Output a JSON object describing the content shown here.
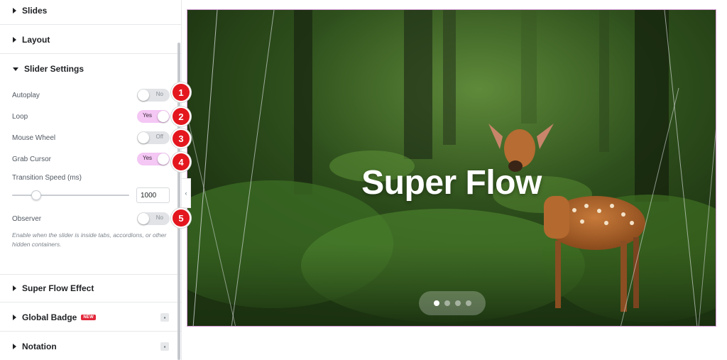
{
  "panel": {
    "sections_top": [
      {
        "label": "Slides"
      },
      {
        "label": "Layout"
      }
    ],
    "slider_settings": {
      "title": "Slider Settings",
      "autoplay": {
        "label": "Autoplay",
        "state": "No"
      },
      "loop": {
        "label": "Loop",
        "state": "Yes"
      },
      "mouse_wheel": {
        "label": "Mouse Wheel",
        "state": "Off"
      },
      "grab_cursor": {
        "label": "Grab Cursor",
        "state": "Yes"
      },
      "transition_speed": {
        "label": "Transition Speed (ms)",
        "value": "1000"
      },
      "observer": {
        "label": "Observer",
        "state": "No"
      },
      "observer_help": "Enable when the slider is inside tabs, accordions, or other hidden containers."
    },
    "sections_bottom": [
      {
        "label": "Super Flow Effect"
      },
      {
        "label": "Global Badge",
        "badge": "NEW"
      },
      {
        "label": "Notation"
      }
    ]
  },
  "callouts": [
    "1",
    "2",
    "3",
    "4",
    "5"
  ],
  "preview": {
    "slide_title": "Super Flow",
    "pagination_count": 4,
    "active_dot": 1
  },
  "colors": {
    "toggle_on": "#f4c7f4",
    "callout": "#e4171f",
    "preview_border": "#d59ad6",
    "badge": "#e2273a"
  }
}
